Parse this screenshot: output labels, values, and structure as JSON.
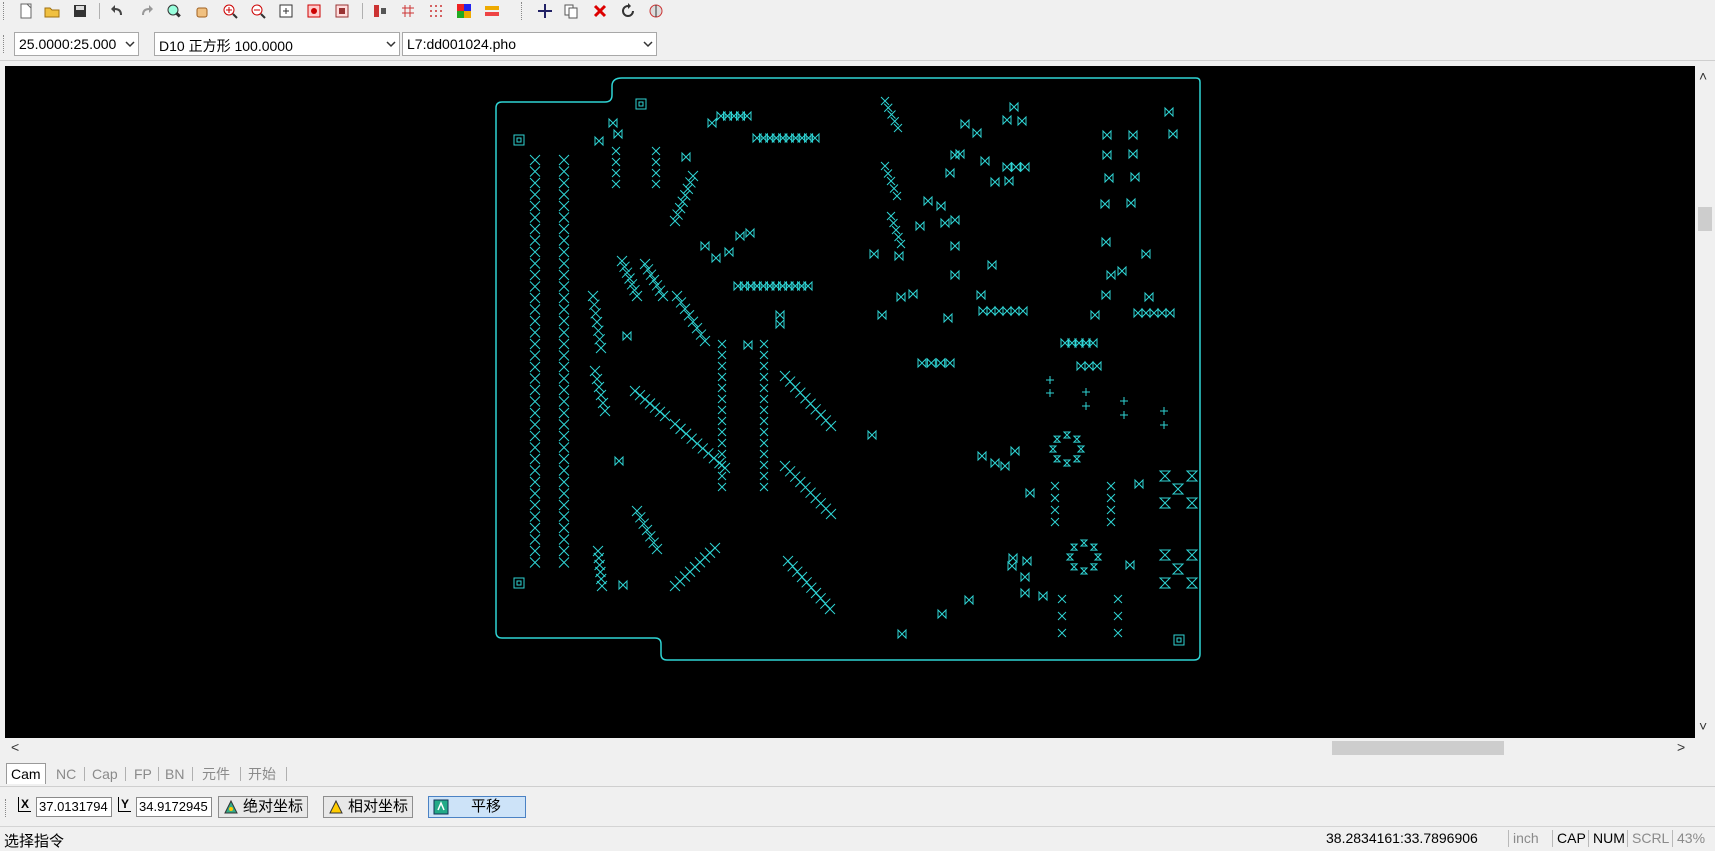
{
  "toolbar": {
    "icons": [
      "new-file-icon",
      "open-folder-icon",
      "save-icon",
      "undo-icon",
      "redo-icon",
      "zoom-window-icon",
      "pan-hand-icon",
      "zoom-in-icon",
      "zoom-out-icon",
      "zoom-fit-icon",
      "zoom-prev-icon",
      "zoom-all-icon",
      "align-icon",
      "grid-icon",
      "grid-dots-icon",
      "layer-color-icon",
      "layer-toggle-icon",
      "move-icon",
      "copy-icon",
      "delete-icon",
      "rotate-icon",
      "mirror-icon"
    ]
  },
  "selectors": {
    "grid": "25.0000:25.000",
    "dcode": "D10  正方形 100.0000",
    "layer": "L7:dd001024.pho"
  },
  "tabs": [
    "Cam",
    "NC",
    "Cap",
    "FP",
    "BN",
    "元件",
    "开始"
  ],
  "active_tab": "Cam",
  "coords": {
    "x_label": "X",
    "y_label": "Y",
    "x_value": "37.0131794",
    "y_value": "34.9172945",
    "absolute_button": "绝对坐标",
    "relative_button": "相对坐标",
    "pan_button": "平移"
  },
  "status": {
    "command_prompt": "选择指令",
    "cursor_position": "38.2834161:33.7896906",
    "unit": "inch",
    "cap": "CAP",
    "num": "NUM",
    "scrl": "SCRL",
    "zoom": "43%"
  },
  "colors": {
    "canvas_bg": "#000000",
    "pcb_outline": "#2fd4d4",
    "pad_color": "#2fd4d4"
  }
}
